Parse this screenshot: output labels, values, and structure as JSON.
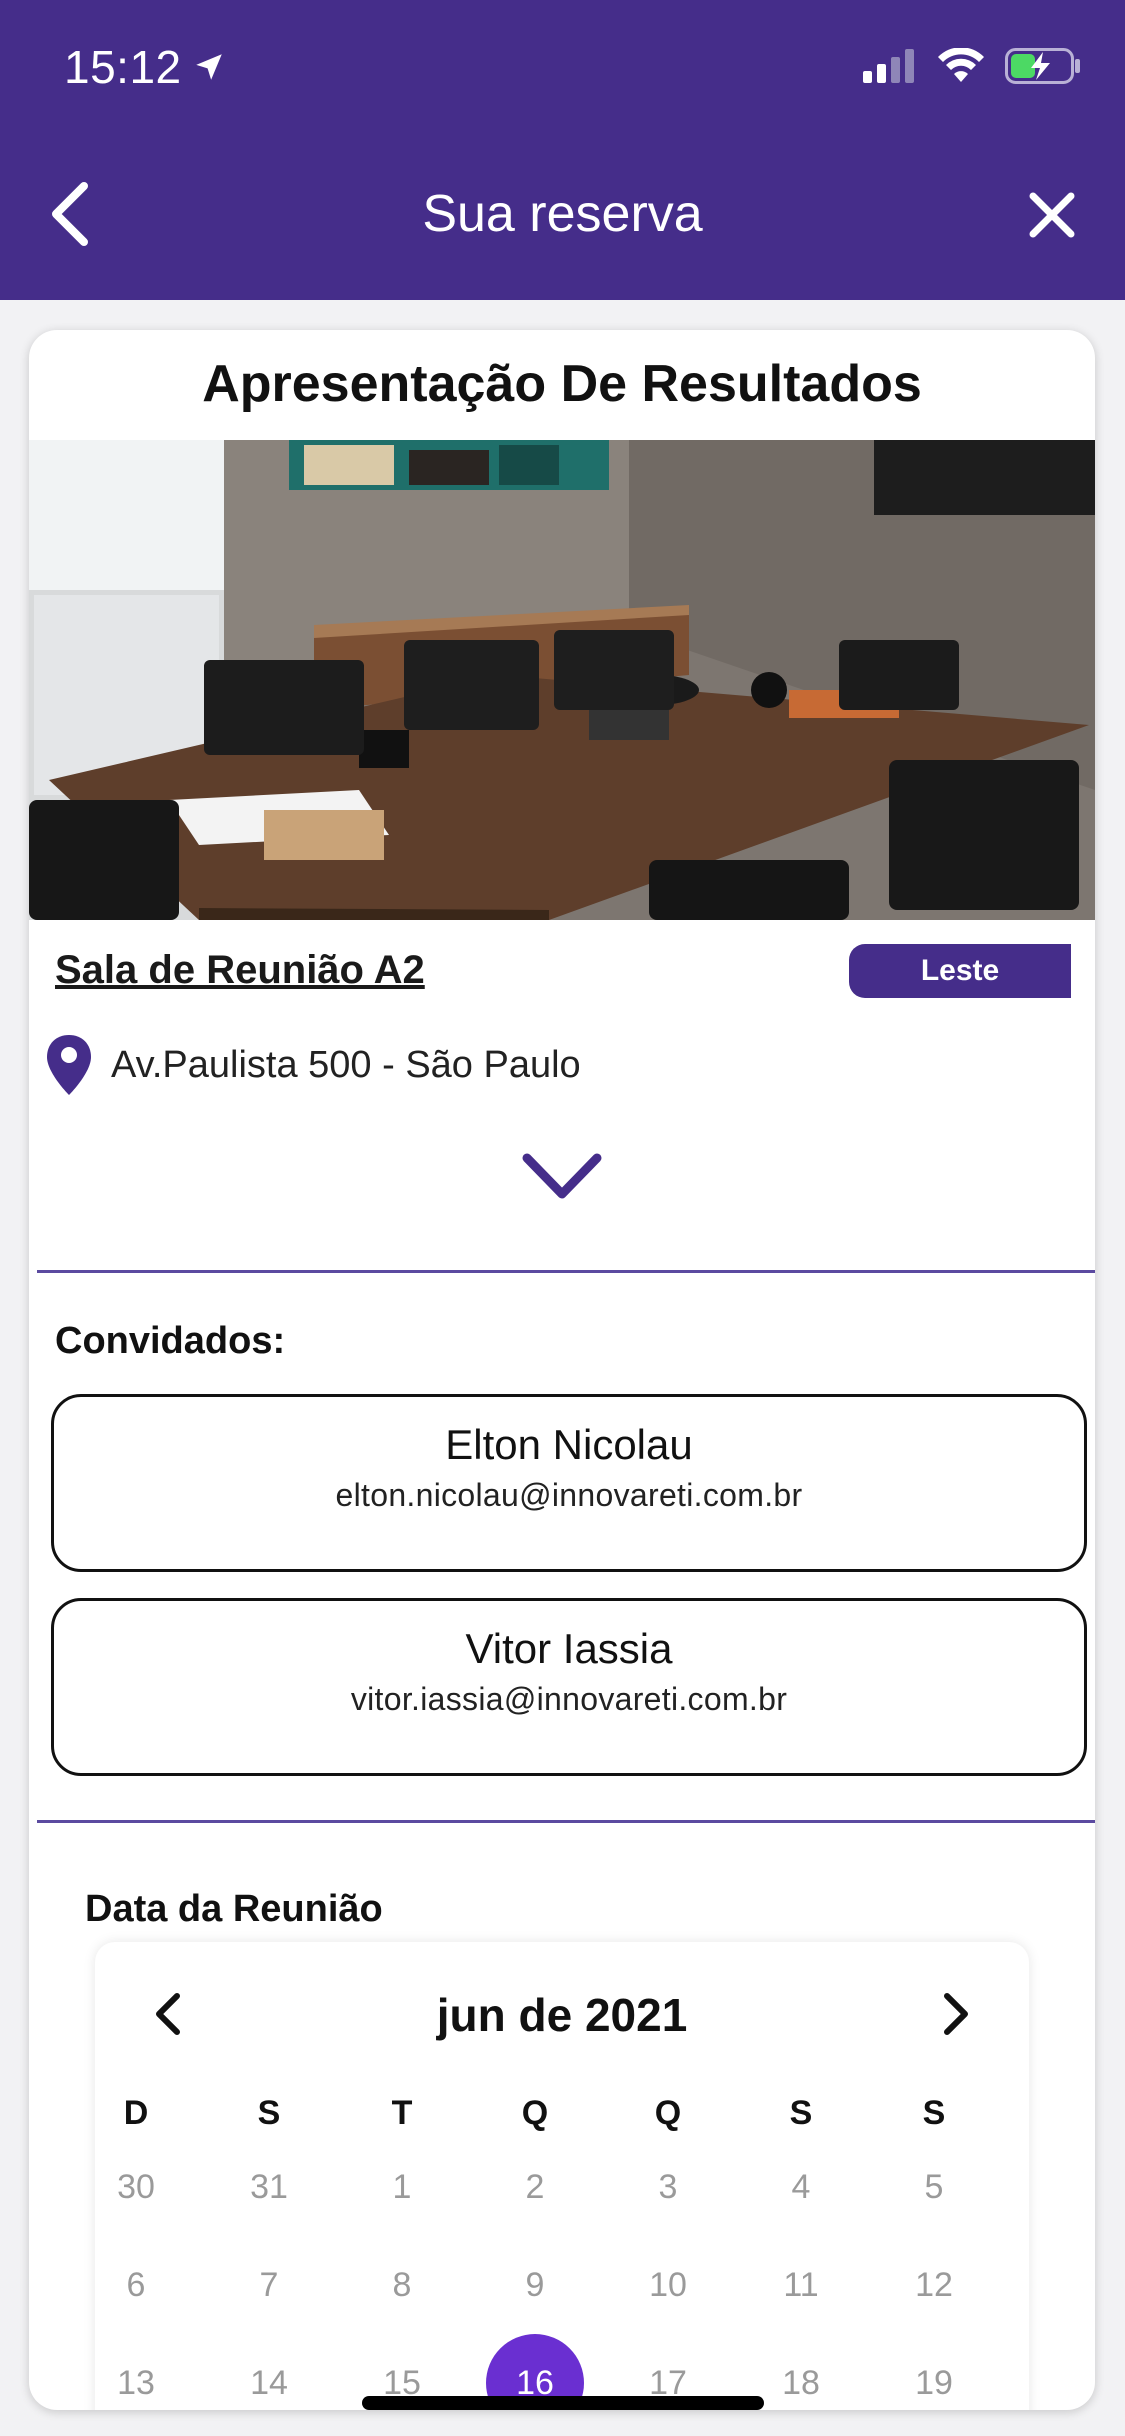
{
  "status": {
    "time": "15:12"
  },
  "nav": {
    "title": "Sua reserva"
  },
  "booking": {
    "title": "Apresentação De Resultados",
    "room": "Sala de Reunião A2",
    "tag": "Leste",
    "address": "Av.Paulista 500 - São Paulo"
  },
  "guests": {
    "label": "Convidados:",
    "items": [
      {
        "name": "Elton Nicolau",
        "email": "elton.nicolau@innovareti.com.br"
      },
      {
        "name": "Vitor Iassia",
        "email": "vitor.iassia@innovareti.com.br"
      }
    ]
  },
  "date": {
    "label": "Data da Reunião",
    "month": "jun de 2021",
    "weekdays": [
      "D",
      "S",
      "T",
      "Q",
      "Q",
      "S",
      "S"
    ],
    "weeks": [
      [
        "30",
        "31",
        "1",
        "2",
        "3",
        "4",
        "5"
      ],
      [
        "6",
        "7",
        "8",
        "9",
        "10",
        "11",
        "12"
      ],
      [
        "13",
        "14",
        "15",
        "16",
        "17",
        "18",
        "19"
      ]
    ],
    "selected": "16"
  },
  "colors": {
    "brand": "#452d8a",
    "selected": "#6a2fd1"
  }
}
